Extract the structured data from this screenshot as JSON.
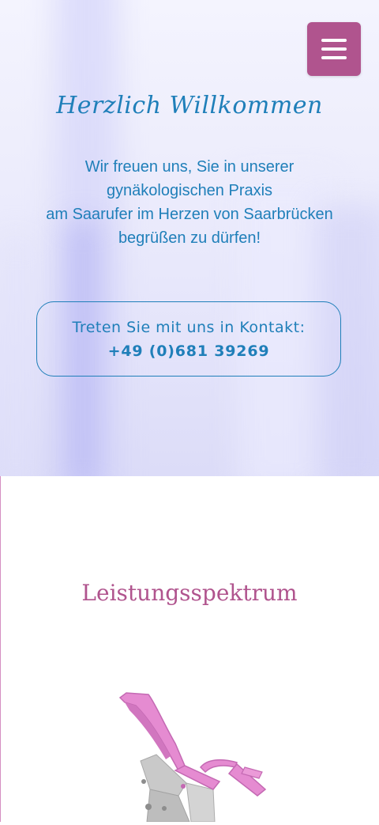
{
  "header": {
    "menu_icon": "hamburger-menu-icon",
    "menu_color": "#b0548e"
  },
  "hero": {
    "title": "Herzlich Willkommen",
    "intro_lines": [
      "Wir freuen uns, Sie in unserer",
      "gynäkologischen Praxis",
      "am Saarufer im Herzen von Saarbrücken",
      "begrüßen zu dürfen!"
    ],
    "contact": {
      "label": "Treten Sie mit uns in Kontakt:",
      "phone": "+49 (0)681 39269"
    }
  },
  "services": {
    "title": "Leistungsspektrum",
    "image_icon": "gynecological-chair-icon"
  },
  "colors": {
    "primary_blue": "#1f7fb9",
    "accent_pink": "#b0548e",
    "chair_pink": "#e58bd1",
    "chair_gray": "#c9c9c9"
  }
}
